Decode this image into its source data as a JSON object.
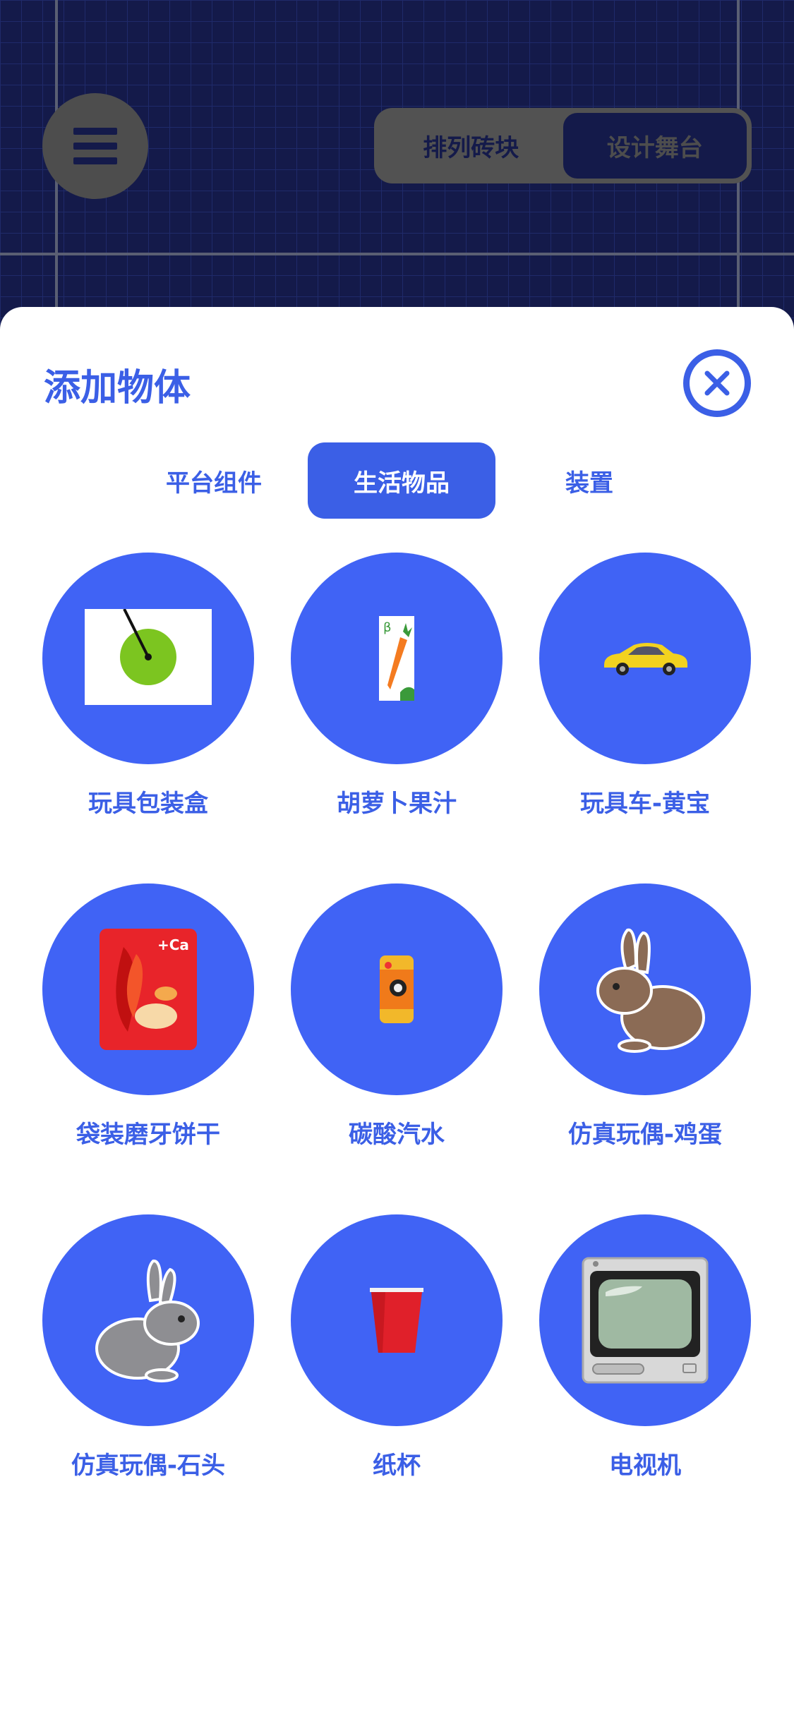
{
  "header": {
    "mode_toggle": [
      "排列砖块",
      "设计舞台"
    ],
    "active_mode": 1
  },
  "sheet": {
    "title": "添加物体",
    "tabs": [
      "平台组件",
      "生活物品",
      "装置"
    ],
    "active_tab": 1,
    "items": [
      {
        "label": "玩具包装盒",
        "icon": "toy-box-icon"
      },
      {
        "label": "胡萝卜果汁",
        "icon": "carrot-juice-icon"
      },
      {
        "label": "玩具车-黄宝",
        "icon": "yellow-toy-car-icon"
      },
      {
        "label": "袋装磨牙饼干",
        "icon": "biscuit-bag-icon"
      },
      {
        "label": "碳酸汽水",
        "icon": "soda-can-icon"
      },
      {
        "label": "仿真玩偶-鸡蛋",
        "icon": "brown-rabbit-icon"
      },
      {
        "label": "仿真玩偶-石头",
        "icon": "grey-rabbit-icon"
      },
      {
        "label": "纸杯",
        "icon": "paper-cup-icon"
      },
      {
        "label": "电视机",
        "icon": "tv-icon"
      }
    ]
  },
  "colors": {
    "accent": "#3b5fe6",
    "item_circle": "#4063f5",
    "canvas": "#141a4a"
  }
}
